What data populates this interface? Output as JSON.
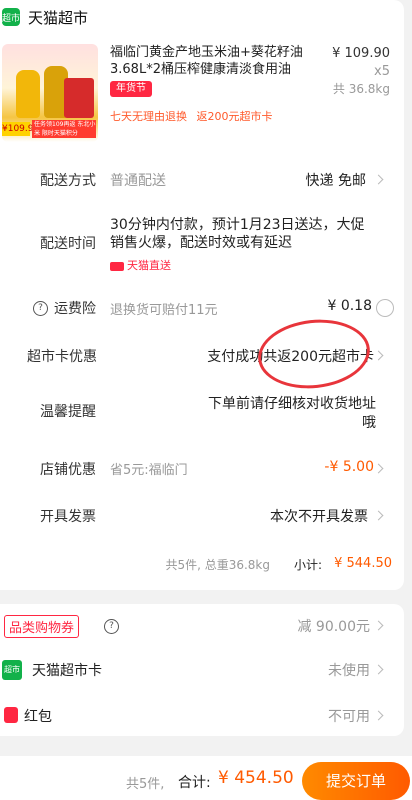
{
  "store": {
    "logo_text": "超市",
    "name": "天猫超市"
  },
  "product": {
    "title": "福临门黄金产地玉米油+葵花籽油3.68L*2桶压榨健康清淡食用油",
    "price": "¥ 109.90",
    "qty": "x5",
    "weight": "共 36.8kg",
    "badge": "年货节",
    "tags": "七天无理由退换 返200元超市卡",
    "image_price": "¥109.9",
    "image_promo": "任务领109再返 东北小米 限时天猫积分"
  },
  "delivery_method": {
    "label": "配送方式",
    "value": "普通配送",
    "right": "快递 免邮"
  },
  "delivery_time": {
    "label": "配送时间",
    "value": "30分钟内付款，预计1月23日送达，大促销售火爆，配送时效或有延迟",
    "brand": "天猫直送"
  },
  "shipping_insurance": {
    "label": "运费险",
    "desc": "退换货可赔付11元",
    "price": "¥ 0.18"
  },
  "supermarket_card": {
    "label": "超市卡优惠",
    "value": "支付成功共返200元超市卡"
  },
  "notice": {
    "label": "温馨提醒",
    "value": "下单前请仔细核对收货地址哦"
  },
  "store_discount": {
    "label": "店铺优惠",
    "desc": "省5元:福临门",
    "value": "-¥ 5.00"
  },
  "invoice": {
    "label": "开具发票",
    "value": "本次不开具发票"
  },
  "subtotal": {
    "summary": "共5件, 总重36.8kg",
    "label": "小计:",
    "amount": "¥ 544.50"
  },
  "coupon": {
    "label": "品类购物券",
    "value": "减 90.00元"
  },
  "tmall_card": {
    "logo": "超市",
    "label": "天猫超市卡",
    "value": "未使用"
  },
  "red_packet": {
    "label": "红包",
    "value": "不可用"
  },
  "footer": {
    "count": "共5件,",
    "total_label": "合计:",
    "total": "¥ 454.50",
    "submit": "提交订单"
  },
  "colors": {
    "accent": "#ff5a00",
    "brand_green": "#12b14a",
    "promo": "#ff2742",
    "annotation": "#e8353b"
  }
}
